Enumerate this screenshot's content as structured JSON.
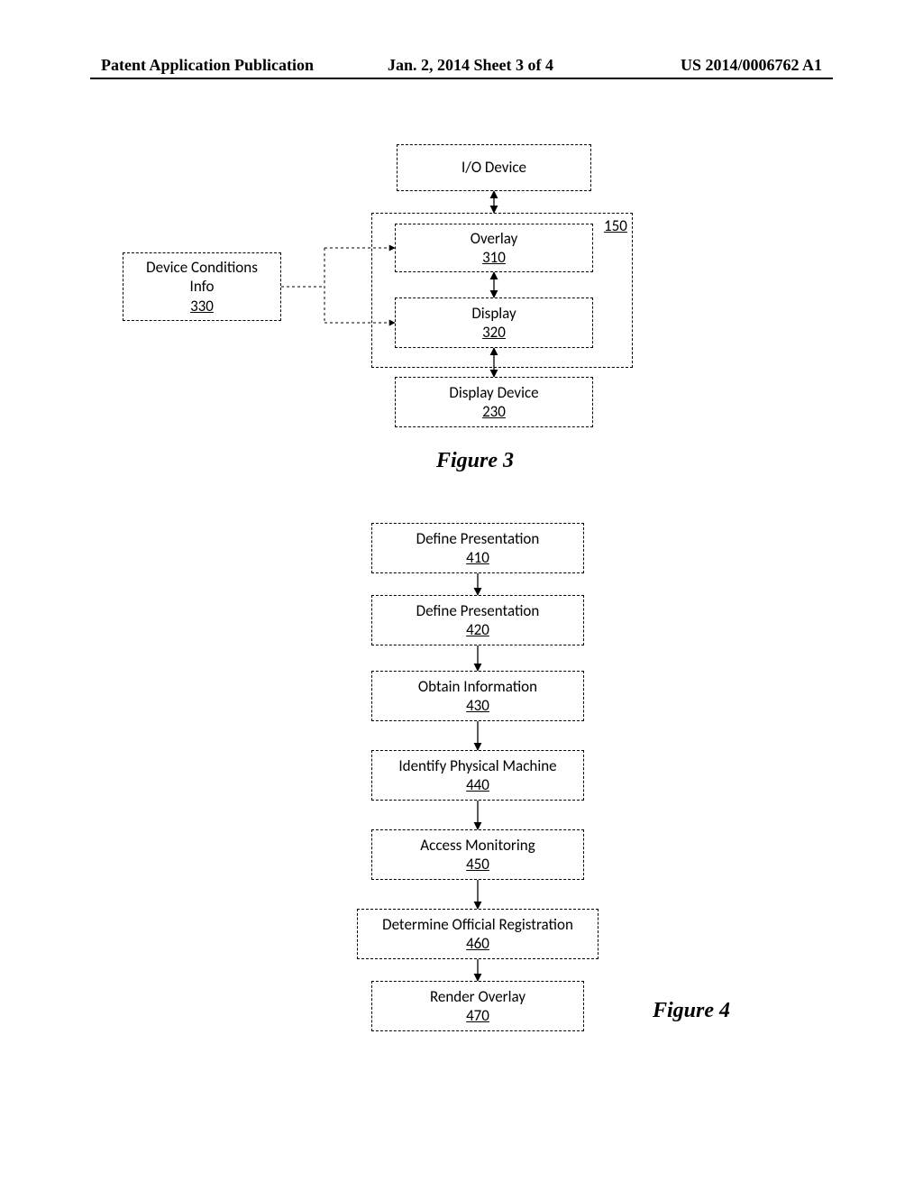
{
  "header": {
    "left": "Patent Application Publication",
    "center": "Jan. 2, 2014   Sheet 3 of 4",
    "right": "US 2014/0006762 A1"
  },
  "fig3": {
    "caption": "Figure 3",
    "container_ref": "150",
    "io_device": {
      "title": "I/O Device",
      "num": ""
    },
    "overlay": {
      "title": "Overlay",
      "num": "310"
    },
    "display": {
      "title": "Display",
      "num": "320"
    },
    "display_device": {
      "title": "Display Device",
      "num": "230"
    },
    "dci": {
      "title1": "Device Conditions",
      "title2": "Info",
      "num": "330"
    }
  },
  "fig4": {
    "caption": "Figure 4",
    "steps": [
      {
        "title": "Define Presentation",
        "num": "410"
      },
      {
        "title": "Define Presentation",
        "num": "420"
      },
      {
        "title": "Obtain Information",
        "num": "430"
      },
      {
        "title": "Identify Physical Machine",
        "num": "440"
      },
      {
        "title": "Access Monitoring",
        "num": "450"
      },
      {
        "title": "Determine Official Registration",
        "num": "460"
      },
      {
        "title": "Render Overlay",
        "num": "470"
      }
    ]
  }
}
